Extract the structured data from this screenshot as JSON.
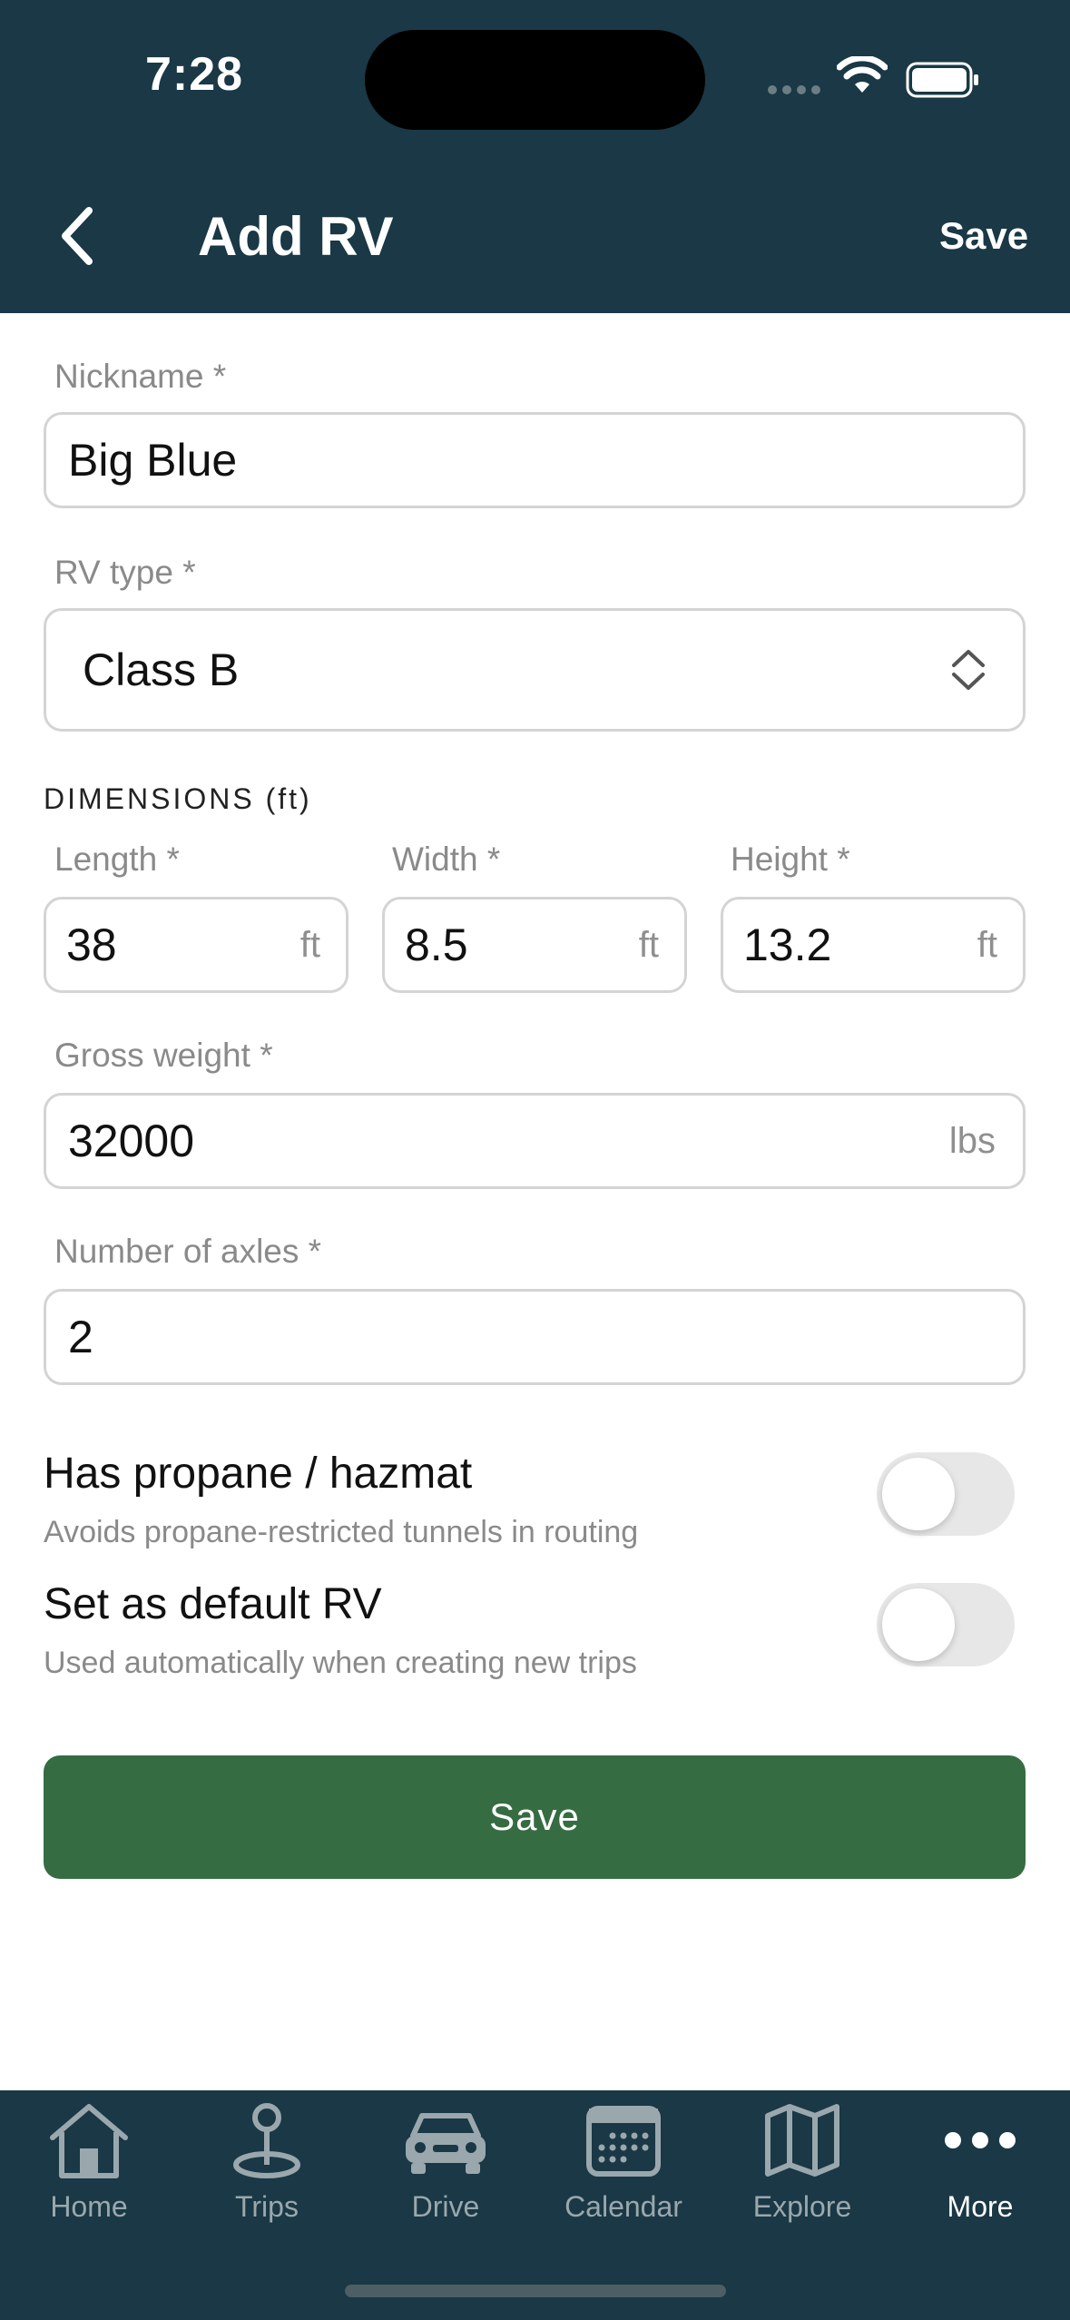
{
  "status": {
    "time": "7:28"
  },
  "nav": {
    "title": "Add RV",
    "save_label": "Save"
  },
  "form": {
    "nickname": {
      "label": "Nickname *",
      "value": "Big Blue"
    },
    "rv_type": {
      "label": "RV type *",
      "value": "Class B"
    },
    "dimensions": {
      "title": "DIMENSIONS (ft)",
      "length": {
        "label": "Length *",
        "value": "38",
        "unit": "ft"
      },
      "width": {
        "label": "Width *",
        "value": "8.5",
        "unit": "ft"
      },
      "height": {
        "label": "Height *",
        "value": "13.2",
        "unit": "ft"
      }
    },
    "gross_weight": {
      "label": "Gross weight *",
      "value": "32000",
      "unit": "lbs"
    },
    "axles": {
      "label": "Number of axles *",
      "value": "2"
    },
    "propane": {
      "title": "Has propane / hazmat",
      "subtitle": "Avoids propane-restricted tunnels in routing",
      "on": false
    },
    "default_rv": {
      "title": "Set as default RV",
      "subtitle": "Used automatically when creating new trips",
      "on": false
    },
    "save_button": "Save"
  },
  "tabs": [
    {
      "label": "Home",
      "icon": "home-icon"
    },
    {
      "label": "Trips",
      "icon": "location-pin-icon"
    },
    {
      "label": "Drive",
      "icon": "car-icon"
    },
    {
      "label": "Calendar",
      "icon": "calendar-icon"
    },
    {
      "label": "Explore",
      "icon": "map-icon"
    },
    {
      "label": "More",
      "icon": "more-dots-icon",
      "active": true
    }
  ],
  "colors": {
    "header_bg": "#1a3845",
    "primary_button": "#366c42",
    "tab_inactive": "#9aa8ad"
  }
}
